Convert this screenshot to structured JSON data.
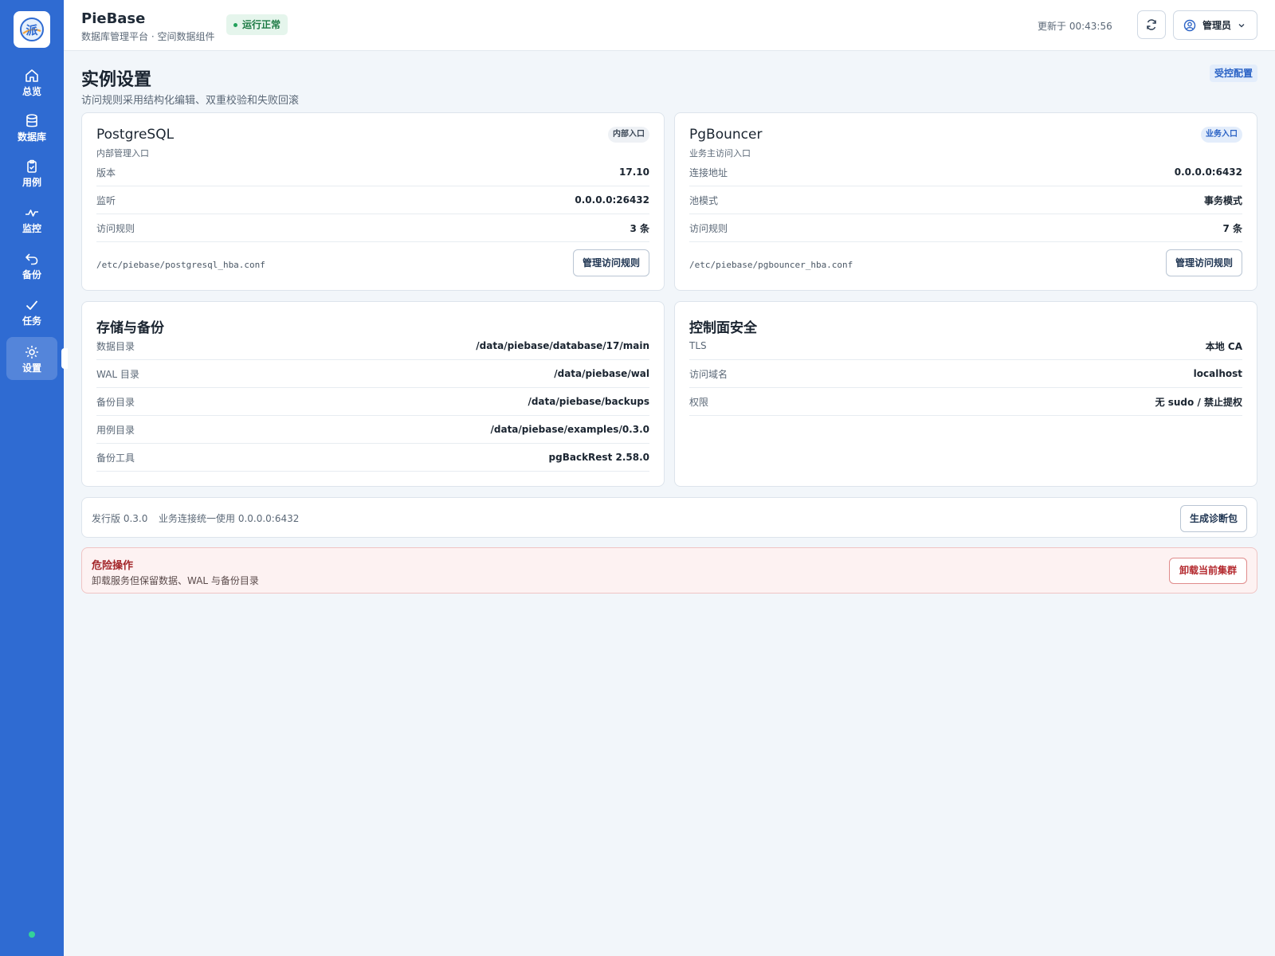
{
  "sidebar": {
    "logo_char": "派",
    "items": [
      {
        "label": "总览",
        "icon": "home-icon"
      },
      {
        "label": "数据库",
        "icon": "database-icon"
      },
      {
        "label": "用例",
        "icon": "clipboard-icon"
      },
      {
        "label": "监控",
        "icon": "activity-icon"
      },
      {
        "label": "备份",
        "icon": "undo-icon"
      },
      {
        "label": "任务",
        "icon": "check-icon"
      },
      {
        "label": "设置",
        "icon": "gear-icon"
      }
    ],
    "active_index": 6
  },
  "header": {
    "app_name": "PieBase",
    "app_subtitle": "数据库管理平台 · 空间数据组件",
    "status": "运行正常",
    "updated": "更新于 00:43:56",
    "user": "管理员"
  },
  "page": {
    "title": "实例设置",
    "subtitle": "访问规则采用结构化编辑、双重校验和失败回滚",
    "badge": "受控配置"
  },
  "postgres": {
    "title": "PostgreSQL",
    "subtitle": "内部管理入口",
    "tag": "内部入口",
    "rows": [
      {
        "k": "版本",
        "v": "17.10"
      },
      {
        "k": "监听",
        "v": "0.0.0.0:26432"
      },
      {
        "k": "访问规则",
        "v": "3 条"
      }
    ],
    "path": "/etc/piebase/postgresql_hba.conf",
    "button": "管理访问规则"
  },
  "pgbouncer": {
    "title": "PgBouncer",
    "subtitle": "业务主访问入口",
    "tag": "业务入口",
    "rows": [
      {
        "k": "连接地址",
        "v": "0.0.0.0:6432"
      },
      {
        "k": "池模式",
        "v": "事务模式"
      },
      {
        "k": "访问规则",
        "v": "7 条"
      }
    ],
    "path": "/etc/piebase/pgbouncer_hba.conf",
    "button": "管理访问规则"
  },
  "storage": {
    "title": "存储与备份",
    "rows": [
      {
        "k": "数据目录",
        "v": "/data/piebase/database/17/main"
      },
      {
        "k": "WAL 目录",
        "v": "/data/piebase/wal"
      },
      {
        "k": "备份目录",
        "v": "/data/piebase/backups"
      },
      {
        "k": "用例目录",
        "v": "/data/piebase/examples/0.3.0"
      },
      {
        "k": "备份工具",
        "v": "pgBackRest 2.58.0"
      }
    ]
  },
  "security": {
    "title": "控制面安全",
    "rows": [
      {
        "k": "TLS",
        "v": "本地 CA"
      },
      {
        "k": "访问域名",
        "v": "localhost"
      },
      {
        "k": "权限",
        "v": "无 sudo / 禁止提权"
      }
    ]
  },
  "footer": {
    "version": "发行版 0.3.0",
    "connection": "业务连接统一使用 0.0.0.0:6432",
    "button": "生成诊断包"
  },
  "danger": {
    "title": "危险操作",
    "description": "卸载服务但保留数据、WAL 与备份目录",
    "button": "卸载当前集群"
  },
  "colors": {
    "sidebar": "#2f6bd2",
    "status_green": "#22a05a",
    "danger_red": "#b3282d",
    "accent_blue": "#2a62c5"
  }
}
